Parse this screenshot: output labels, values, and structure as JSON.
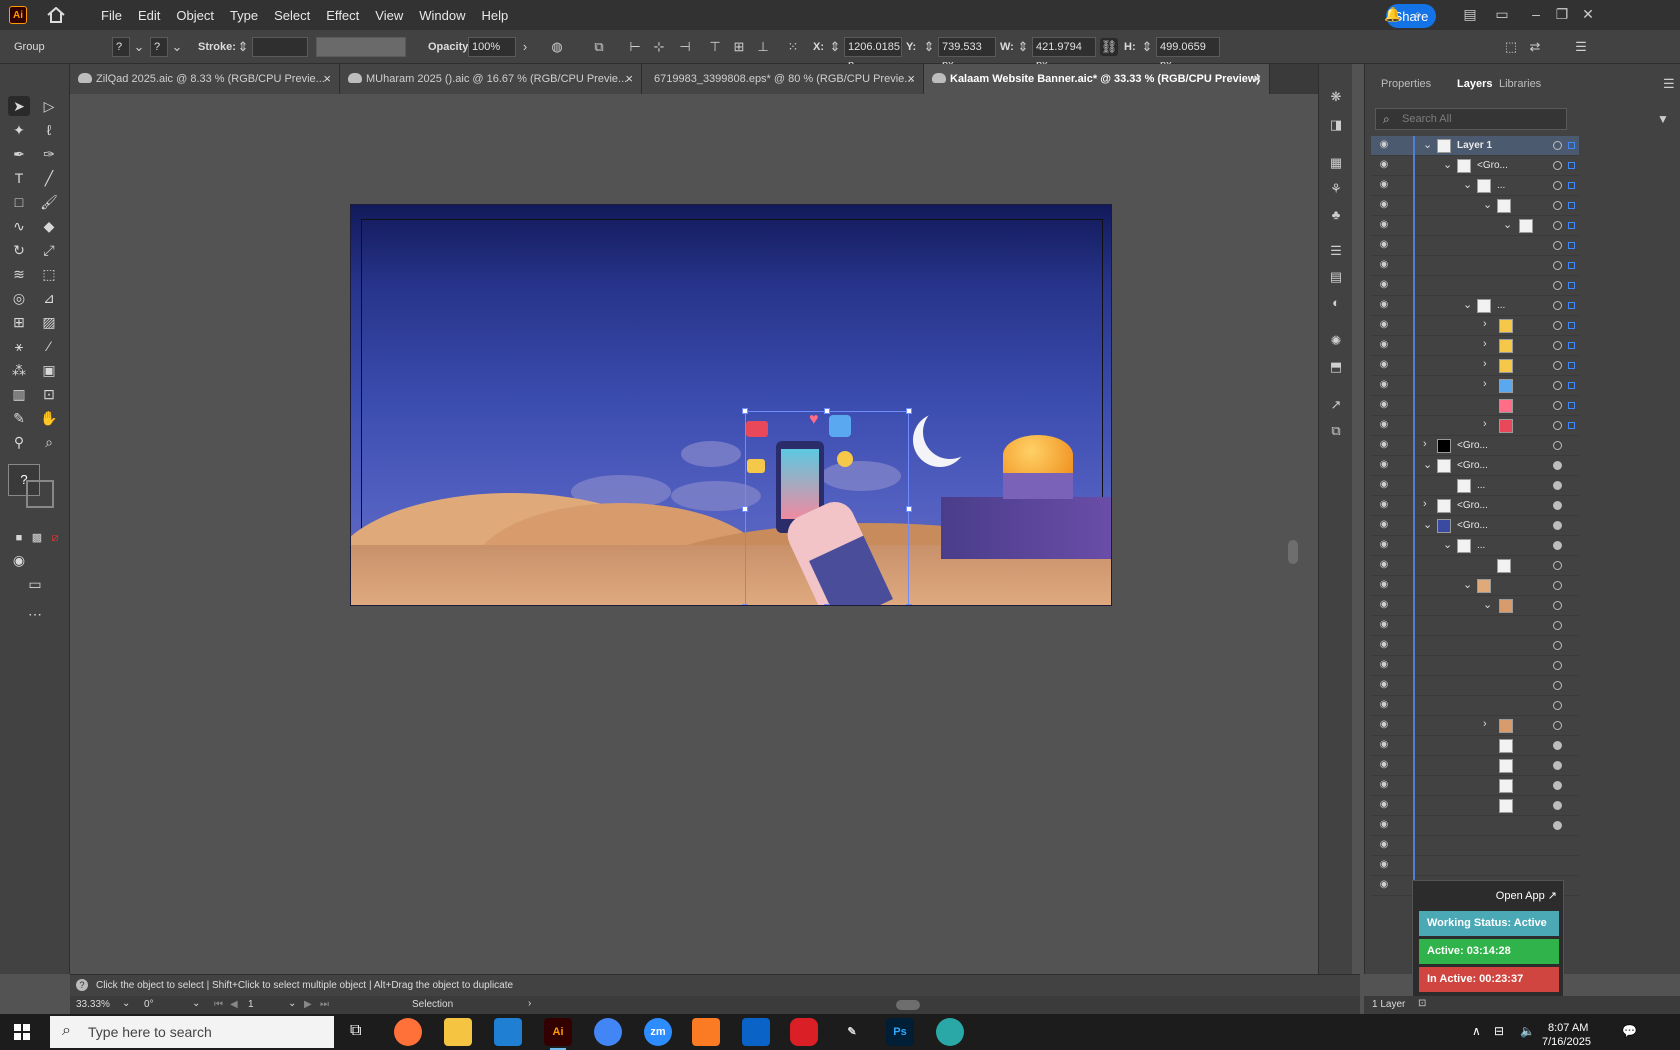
{
  "app": {
    "logo": "Ai"
  },
  "menu": [
    "File",
    "Edit",
    "Object",
    "Type",
    "Select",
    "Effect",
    "View",
    "Window",
    "Help"
  ],
  "share_label": "Share",
  "control": {
    "selection_type": "Group",
    "stroke_label": "Stroke:",
    "opacity_label": "Opacity:",
    "opacity_value": "100%",
    "x_label": "X:",
    "x_value": "1206.0185 p",
    "y_label": "Y:",
    "y_value": "739.533 px",
    "w_label": "W:",
    "w_value": "421.9794 px",
    "h_label": "H:",
    "h_value": "499.0659 px"
  },
  "tabs": [
    {
      "label": "ZilQad 2025.aic @ 8.33 % (RGB/CPU Previe...",
      "active": false
    },
    {
      "label": "MUharam 2025 ().aic @ 16.67 % (RGB/CPU Previe...",
      "active": false
    },
    {
      "label": "6719983_3399808.eps* @ 80 % (RGB/CPU Previe...",
      "active": false
    },
    {
      "label": "Kalaam Website Banner.aic* @ 33.33 % (RGB/CPU Preview)",
      "active": true
    }
  ],
  "panel_tabs": [
    "Properties",
    "Layers",
    "Libraries"
  ],
  "layers_search_placeholder": "Search All",
  "layers": {
    "layer1": "Layer 1",
    "group": "<Gro...",
    "ellipsis": "...",
    "count": "1 Layer"
  },
  "status": {
    "hint": "Click the object to select  |  Shift+Click to select multiple object  |  Alt+Drag the object to duplicate",
    "zoom": "33.33%",
    "rotation": "0°",
    "artboard": "1",
    "tool": "Selection"
  },
  "overlay": {
    "open_app": "Open App ↗",
    "working": "Working Status: Active",
    "active": "Active: 03:14:28",
    "inactive": "In Active: 00:23:37"
  },
  "taskbar": {
    "search_placeholder": "Type here to search",
    "time": "8:07 AM",
    "date": "7/16/2025",
    "apps": [
      "Firefox",
      "Files",
      "VS Code",
      "Ai",
      "Chrome",
      "Zoom",
      "XAMPP",
      "Outlook",
      "Creative Cloud",
      "Pen",
      "Ps",
      "App"
    ]
  },
  "colors": {
    "accent": "#1473e6",
    "working": "#4aa9b5",
    "active": "#2fb34a",
    "inactive": "#d0453f"
  }
}
